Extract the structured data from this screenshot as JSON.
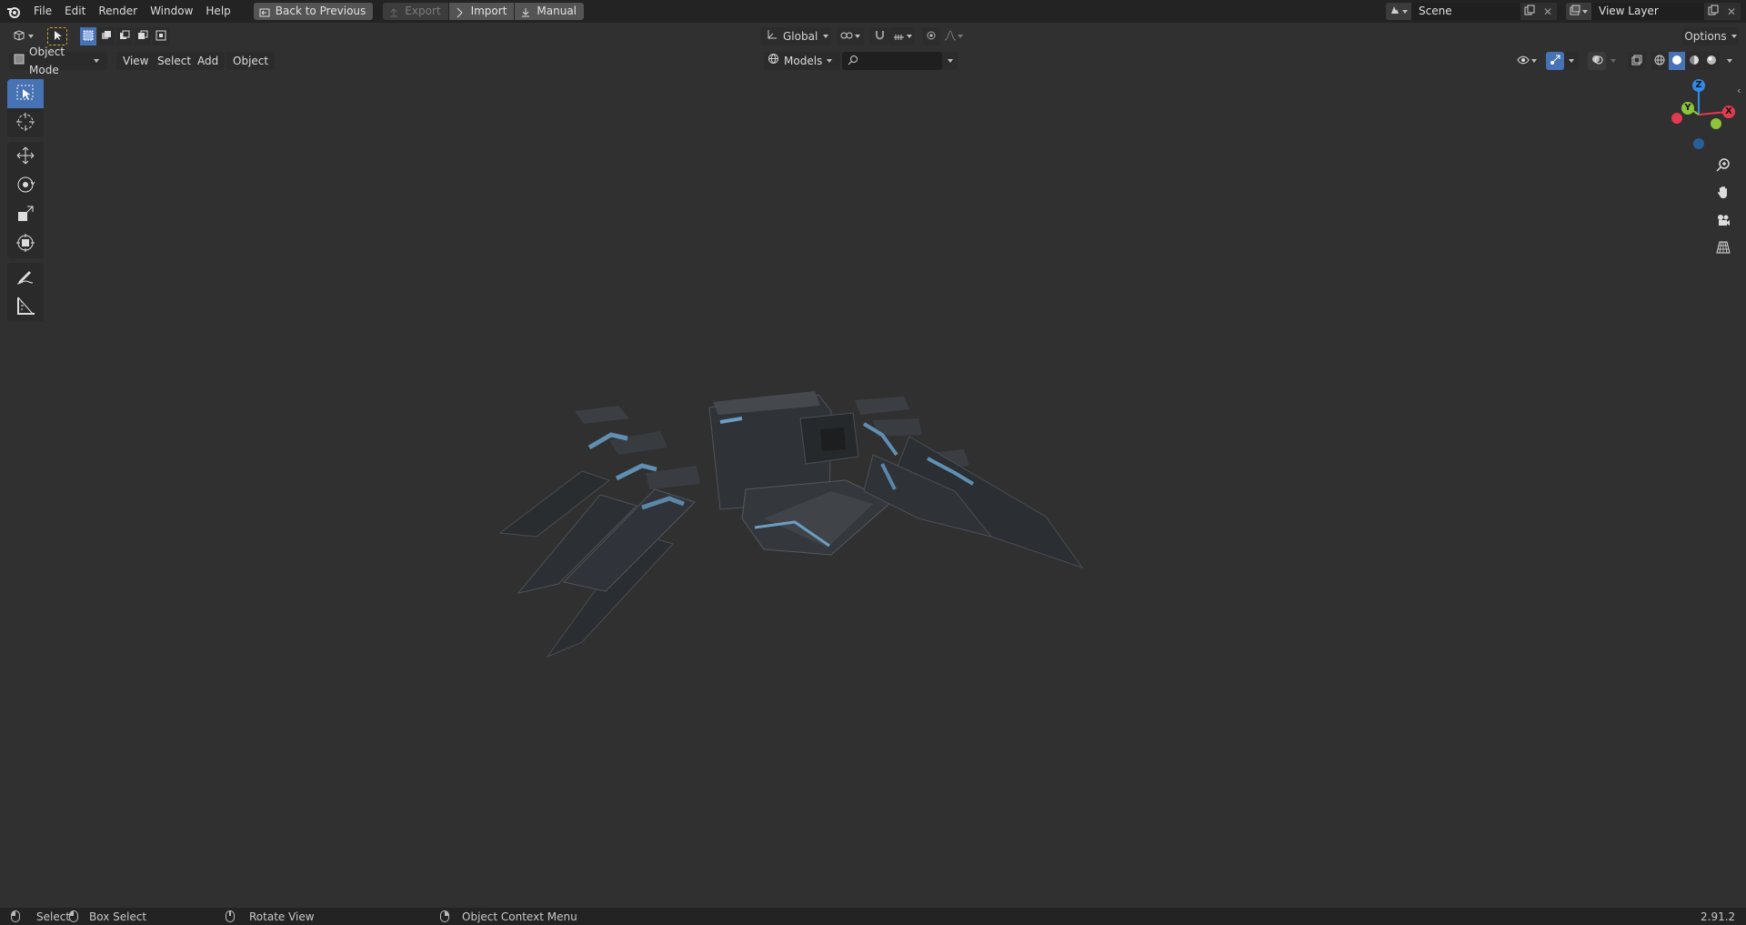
{
  "topbar": {
    "menus": [
      "File",
      "Edit",
      "Render",
      "Window",
      "Help"
    ],
    "buttons": {
      "back": "Back to Previous",
      "export": "Export",
      "import": "Import",
      "manual": "Manual"
    },
    "scene": "Scene",
    "view_layer": "View Layer"
  },
  "header1": {
    "orientation": "Global",
    "options": "Options"
  },
  "header2": {
    "mode": "Object Mode",
    "menus": [
      "View",
      "Select",
      "Add",
      "Object"
    ],
    "collection": "Models",
    "search_placeholder": ""
  },
  "gizmo": {
    "z": "Z",
    "y": "Y",
    "x": "X",
    "colors": {
      "x": "#e23a4f",
      "y": "#8dc43a",
      "z": "#2e8ceb"
    }
  },
  "statusbar": {
    "select": "Select",
    "box_select": "Box Select",
    "rotate_view": "Rotate View",
    "context_menu": "Object Context Menu",
    "version": "2.91.2"
  },
  "theme": {
    "accent": "#4772b3",
    "viewport": "#303030"
  }
}
